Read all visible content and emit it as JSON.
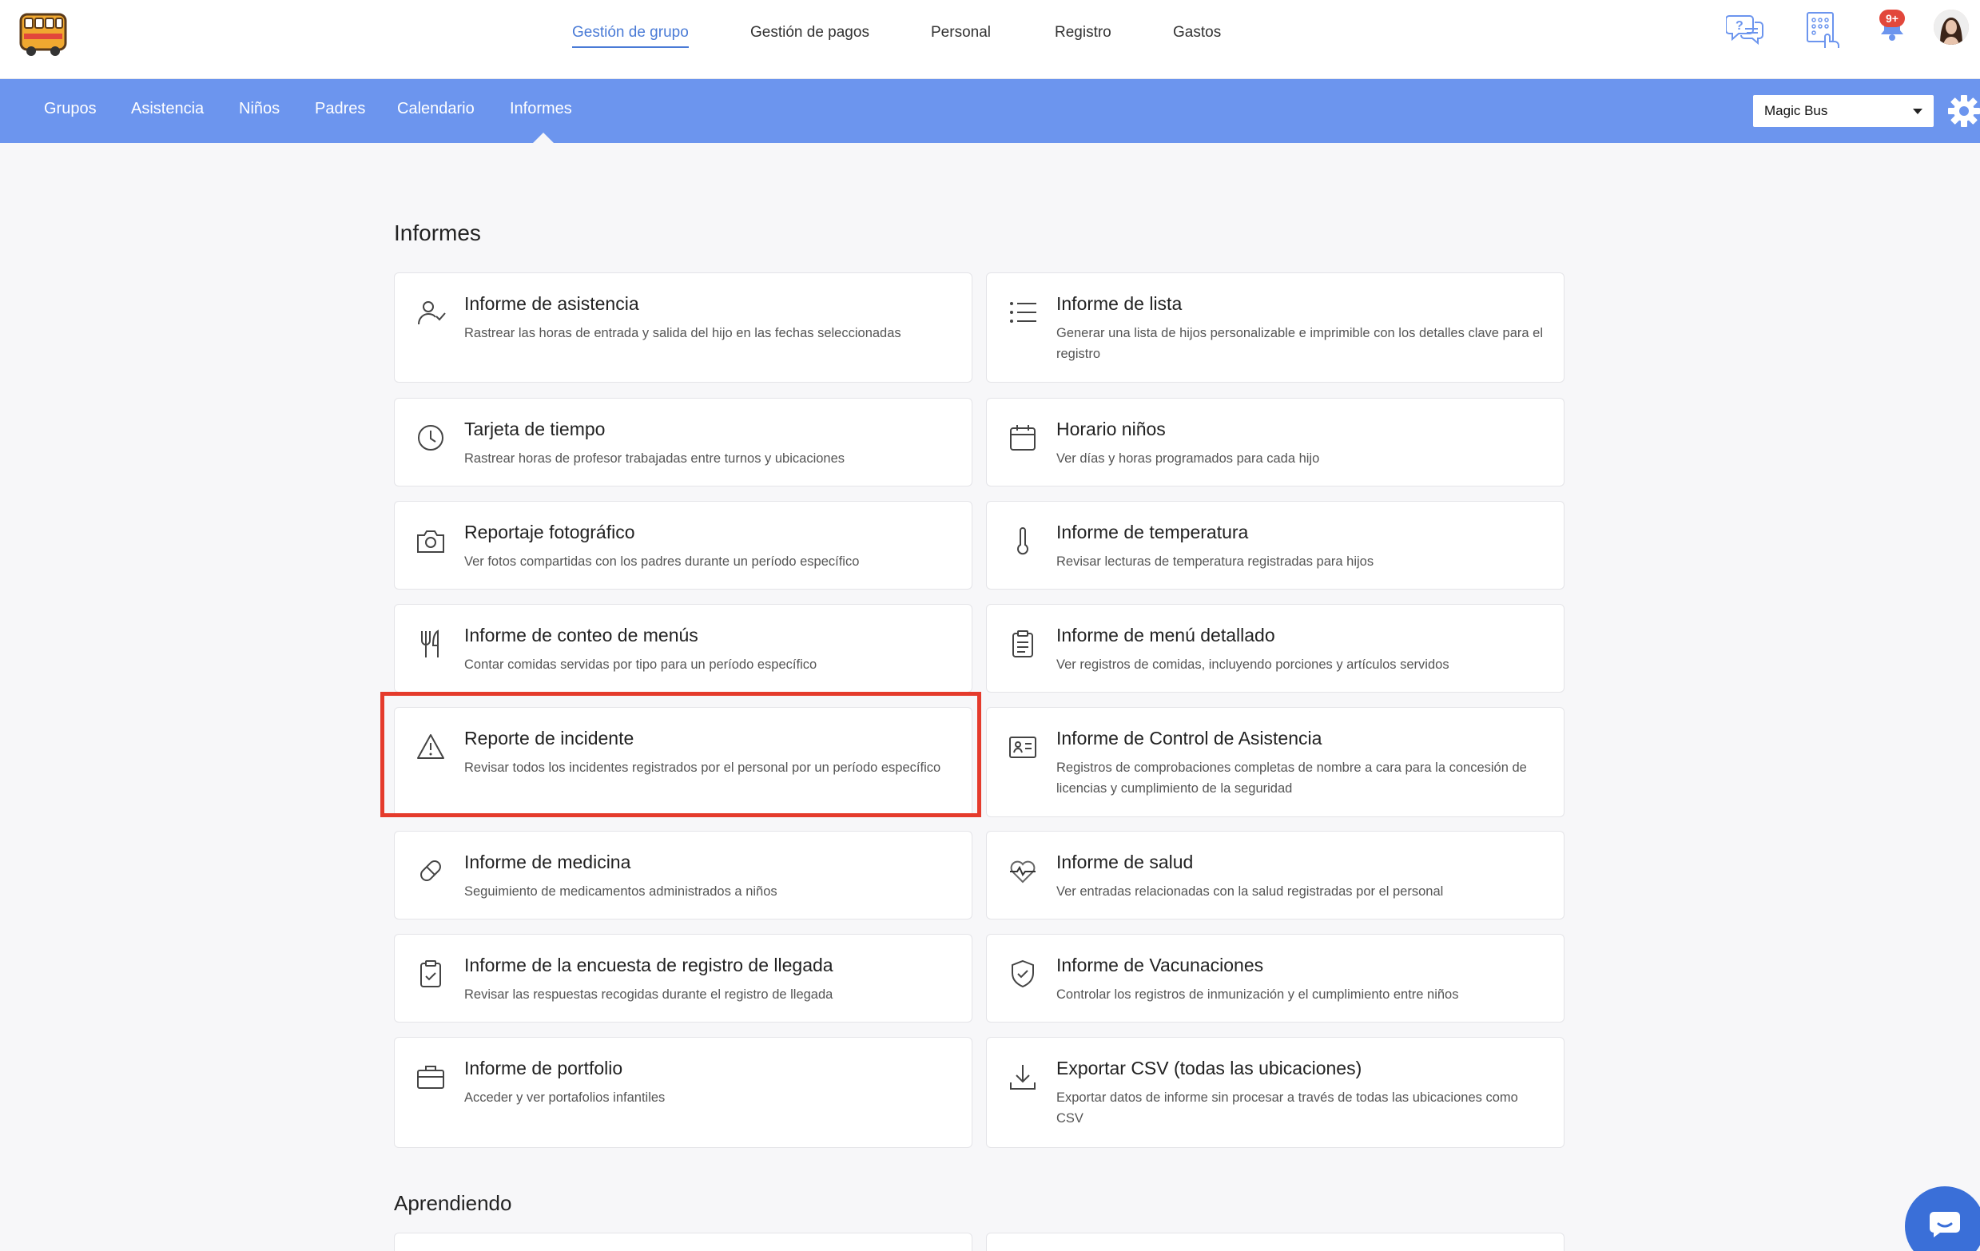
{
  "topnav": {
    "items": [
      {
        "label": "Gestión de grupo",
        "active": true
      },
      {
        "label": "Gestión de pagos"
      },
      {
        "label": "Personal"
      },
      {
        "label": "Registro"
      },
      {
        "label": "Gastos"
      }
    ],
    "icons": [
      "help-chat-icon",
      "kiosk-icon",
      "bell-icon"
    ],
    "notification_badge": "9+",
    "logo": "magic-bus-logo"
  },
  "subnav": {
    "items": [
      {
        "label": "Grupos"
      },
      {
        "label": "Asistencia"
      },
      {
        "label": "Niños"
      },
      {
        "label": "Padres"
      },
      {
        "label": "Calendario"
      },
      {
        "label": "Informes",
        "active": true
      }
    ],
    "location_select": "Magic Bus",
    "background": "#6c95ee"
  },
  "sections": {
    "informes_title": "Informes",
    "aprendiendo_title": "Aprendiendo"
  },
  "cards": [
    {
      "icon": "person-check-icon",
      "title": "Informe de asistencia",
      "desc": "Rastrear las horas de entrada y salida del hijo en las fechas seleccionadas"
    },
    {
      "icon": "list-icon",
      "title": "Informe de lista",
      "desc": "Generar una lista de hijos personalizable e imprimible con los detalles clave para el registro"
    },
    {
      "icon": "clock-icon",
      "title": "Tarjeta de tiempo",
      "desc": "Rastrear horas de profesor trabajadas entre turnos y ubicaciones"
    },
    {
      "icon": "calendar-icon",
      "title": "Horario niños",
      "desc": "Ver días y horas programados para cada hijo"
    },
    {
      "icon": "camera-icon",
      "title": "Reportaje fotográfico",
      "desc": "Ver fotos compartidas con los padres durante un período específico"
    },
    {
      "icon": "thermometer-icon",
      "title": "Informe de temperatura",
      "desc": "Revisar lecturas de temperatura registradas para hijos"
    },
    {
      "icon": "utensils-icon",
      "title": "Informe de conteo de menús",
      "desc": "Contar comidas servidas por tipo para un período específico"
    },
    {
      "icon": "clipboard-icon",
      "title": "Informe de menú detallado",
      "desc": "Ver registros de comidas, incluyendo porciones y artículos servidos"
    },
    {
      "icon": "warning-icon",
      "title": "Reporte de incidente",
      "desc": "Revisar todos los incidentes registrados por el personal por un período específico",
      "highlighted": true
    },
    {
      "icon": "id-card-icon",
      "title": "Informe de Control de Asistencia",
      "desc": "Registros de comprobaciones completas de nombre a cara para la concesión de licencias y cumplimiento de la seguridad"
    },
    {
      "icon": "pill-icon",
      "title": "Informe de medicina",
      "desc": "Seguimiento de medicamentos administrados a niños"
    },
    {
      "icon": "heart-pulse-icon",
      "title": "Informe de salud",
      "desc": "Ver entradas relacionadas con la salud registradas por el personal"
    },
    {
      "icon": "clipboard-check-icon",
      "title": "Informe de la encuesta de registro de llegada",
      "desc": "Revisar las respuestas recogidas durante el registro de llegada"
    },
    {
      "icon": "shield-check-icon",
      "title": "Informe de Vacunaciones",
      "desc": "Controlar los registros de inmunización y el cumplimiento entre niños"
    },
    {
      "icon": "briefcase-icon",
      "title": "Informe de portfolio",
      "desc": "Acceder y ver portafolios infantiles"
    },
    {
      "icon": "download-icon",
      "title": "Exportar CSV (todas las ubicaciones)",
      "desc": "Exportar datos de informe sin procesar a través de todas las ubicaciones como CSV"
    }
  ],
  "colors": {
    "accent": "#4a7bd6",
    "highlight": "#e53b2c",
    "chat": "#3a6fd8"
  }
}
